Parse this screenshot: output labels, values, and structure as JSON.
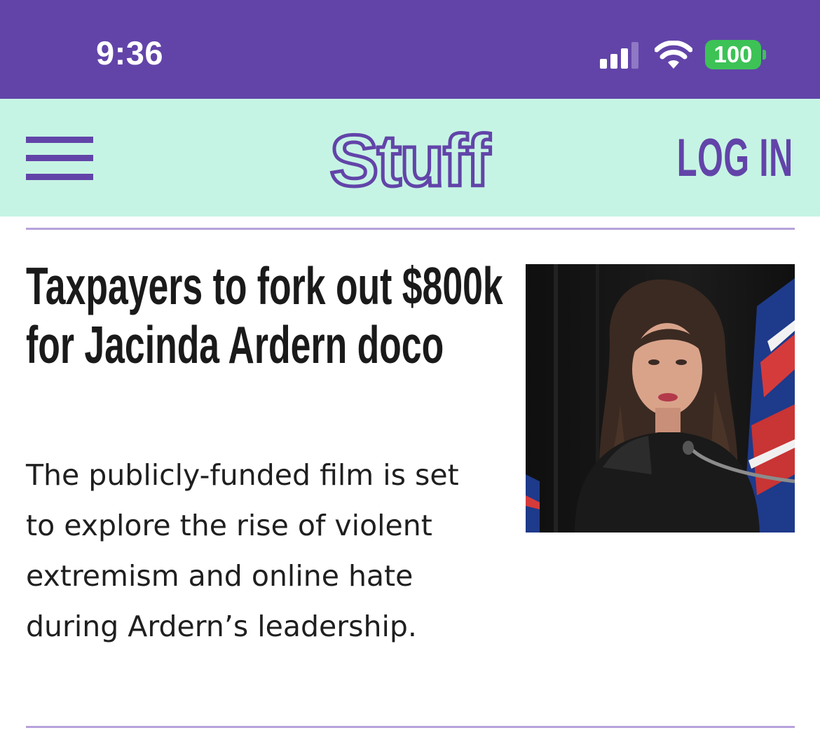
{
  "status_bar": {
    "time": "9:36",
    "battery_level": "100",
    "signal_bars_filled": 3,
    "signal_bars_total": 4,
    "wifi": "connected",
    "background_color": "#6244a9"
  },
  "header": {
    "logo_text": "Stuff",
    "login_label": "LOG IN",
    "menu_icon": "hamburger-menu-icon",
    "background_color": "#c6f4e4",
    "brand_color": "#6244a9"
  },
  "article": {
    "headline": "Taxpayers to fork out $800k for Jacinda Ardern doco",
    "summary": "The publicly-funded film is set to explore the rise of violent extremism and online hate during Ardern’s leadership.",
    "thumbnail": "photo of a woman with long dark hair speaking at a microphone in front of a New Zealand flag"
  },
  "colors": {
    "divider": "#b7a2db",
    "battery": "#3dc256",
    "text": "#1a1a1a"
  }
}
